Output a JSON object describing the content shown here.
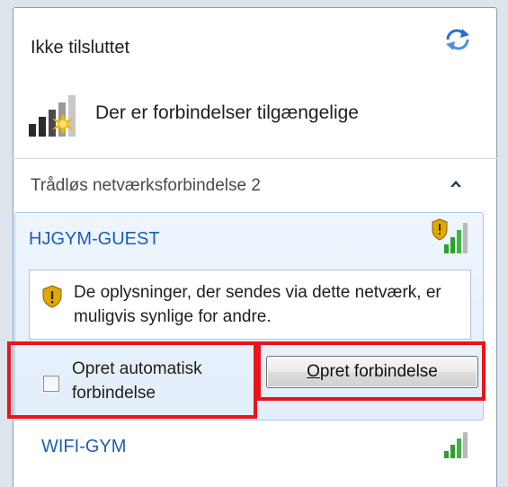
{
  "status": {
    "title": "Ikke tilsluttet",
    "available_text": "Der er forbindelser tilgængelige"
  },
  "section": {
    "label": "Trådløs netværksforbindelse 2"
  },
  "networks": [
    {
      "name": "HJGYM-GUEST",
      "secured": false,
      "warning": "De oplysninger, der sendes via dette netværk, er muligvis synlige for andre.",
      "auto_connect_label": "Opret automatisk forbindelse",
      "auto_connect_checked": false,
      "connect_button": "Opret forbindelse",
      "connect_accesskey": "O"
    },
    {
      "name": "WIFI-GYM"
    }
  ],
  "icons": {
    "refresh": "refresh-icon",
    "network_status": "wireless-network-available-icon",
    "collapse": "chevron-up-icon",
    "signal": "signal-strength-icon",
    "warning_shield": "shield-warning-icon"
  },
  "colors": {
    "link_blue": "#1a5fb4",
    "highlight_red": "#e8141c",
    "selected_bg": "#e3eefb",
    "signal_green": "#2f9e2f",
    "shield_gold": "#e0a800"
  }
}
